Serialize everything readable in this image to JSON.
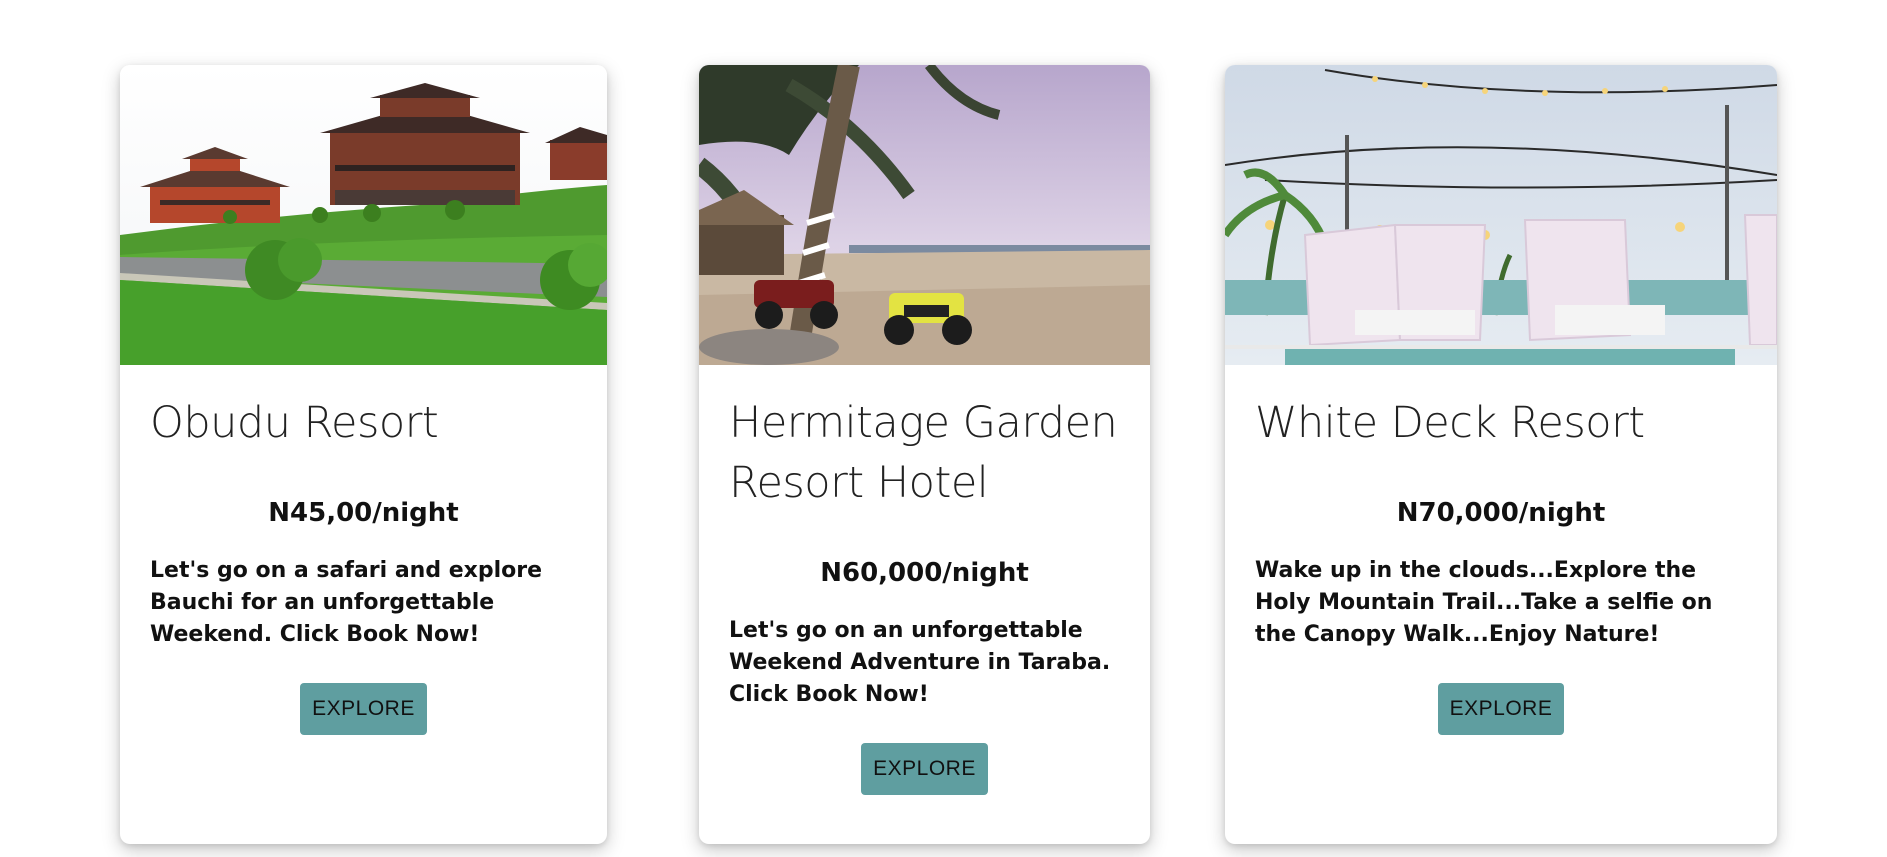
{
  "cards": [
    {
      "title": "Obudu Resort",
      "price": "N45,00/night",
      "description": "Let's go on a safari and explore Bauchi for an unforgettable Weekend. Click Book Now!",
      "button_label": "EXPLORE"
    },
    {
      "title": "Hermitage Garden Resort Hotel",
      "price": "N60,000/night",
      "description": "Let's go on an unforgettable Weekend Adventure in Taraba. Click Book Now!",
      "button_label": "EXPLORE"
    },
    {
      "title": "White Deck Resort",
      "price": "N70,000/night",
      "description": "Wake up in the clouds...Explore the Holy Mountain Trail...Take a selfie on the Canopy Walk...Enjoy Nature!",
      "button_label": "EXPLORE"
    }
  ],
  "colors": {
    "button_bg": "#5f9ea0",
    "card_bg": "#ffffff"
  }
}
